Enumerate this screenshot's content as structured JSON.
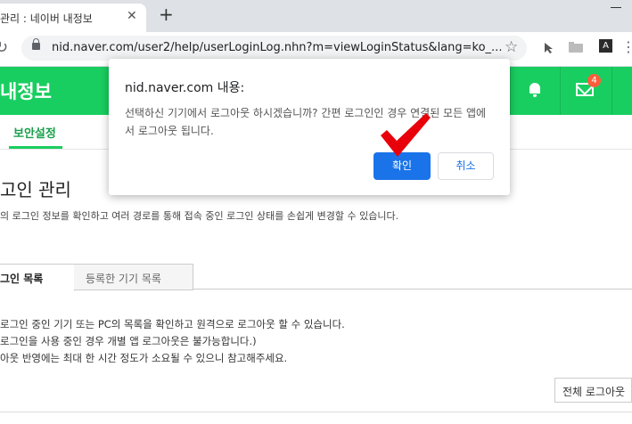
{
  "browser": {
    "tab_title": "관리 : 네이버 내정보",
    "close_glyph": "✕",
    "new_tab_glyph": "+",
    "url": "nid.naver.com/user2/help/userLoginLog.nhn?m=viewLoginStatus&lang=ko_...",
    "star_glyph": "☆",
    "ext_a_label": "A",
    "menu_glyph": "⋮",
    "reload_glyph": "↻"
  },
  "header": {
    "title": "내정보",
    "mail_count": "4",
    "menu_glyph": "⋮",
    "color": "#19ce60"
  },
  "subnav": {
    "item": "보안설정"
  },
  "main": {
    "title": "고인 관리",
    "description": "의 로그인 정보를 확인하고 여러 경로를 통해 접속 중인 로그인 상태를 손쉽게 변경할 수 있습니다.",
    "tab_active": "그인 목록",
    "tab_inactive": "등록한 기기 목록",
    "info_line1": "로그인 중인 기기 또는 PC의 목록을 확인하고 원격으로 로그아웃 할 수 있습니다.",
    "info_line2": "로그인을 사용 중인 경우 개별 앱 로그아웃은 불가능합니다.)",
    "info_line3": "아웃 반영에는 최대 한 시간 정도가 소요될 수 있으니 참고해주세요.",
    "logout_all": "전체 로그아웃"
  },
  "dialog": {
    "title": "nid.naver.com 내용:",
    "message": "선택하신 기기에서 로그아웃 하시겠습니까? 간편 로그인인 경우 연결된 모든 앱에서 로그아웃 됩니다.",
    "ok_label": "확인",
    "cancel_label": "취소",
    "annotation_color": "#e8000b"
  }
}
